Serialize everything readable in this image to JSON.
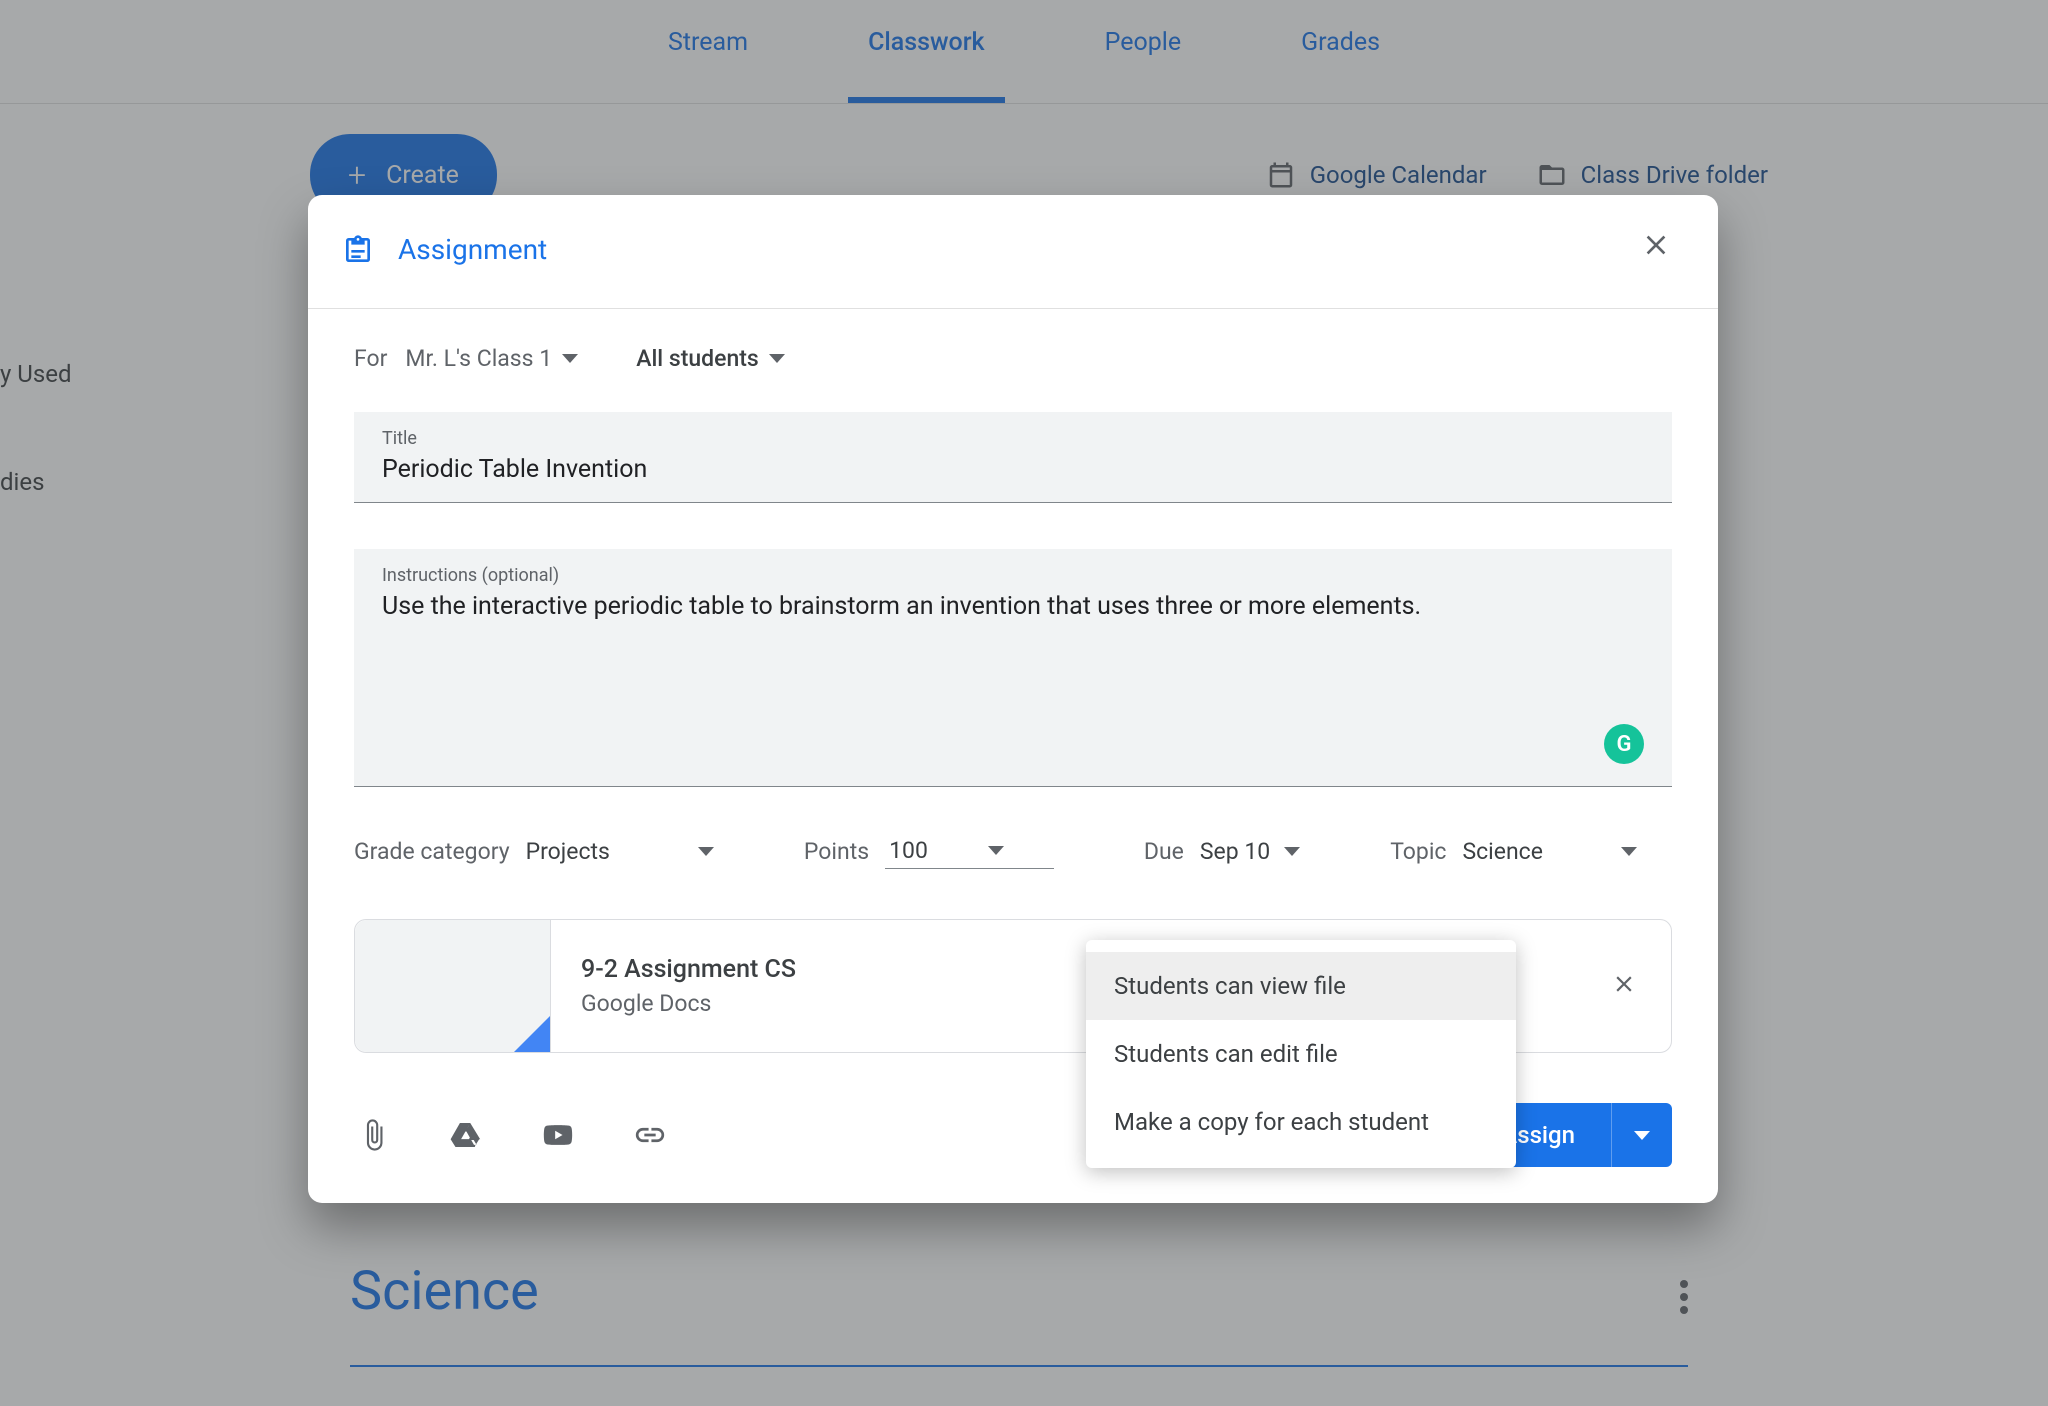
{
  "header_tabs": {
    "stream": "Stream",
    "classwork": "Classwork",
    "people": "People",
    "grades": "Grades"
  },
  "toolbar": {
    "create_label": "Create",
    "calendar_label": "Google Calendar",
    "drive_label": "Class Drive folder"
  },
  "sidebar": {
    "item1": "y Used",
    "item2": "dies"
  },
  "section": {
    "title": "Science"
  },
  "modal": {
    "title": "Assignment",
    "for_label": "For",
    "class_name": "Mr. L's Class 1",
    "students_label": "All students",
    "title_label": "Title",
    "title_value": "Periodic Table Invention",
    "instructions_label": "Instructions (optional)",
    "instructions_value": "Use the interactive periodic table to brainstorm an invention that uses three or more elements.",
    "grammarly": "G",
    "grade_category_label": "Grade category",
    "grade_category_value": "Projects",
    "points_label": "Points",
    "points_value": "100",
    "due_label": "Due",
    "due_value": "Sep 10",
    "topic_label": "Topic",
    "topic_value": "Science",
    "attachment": {
      "title": "9-2 Assignment CS",
      "type": "Google Docs"
    },
    "permission_menu": {
      "view": "Students can view file",
      "edit": "Students can edit file",
      "copy": "Make a copy for each student"
    },
    "assign_label": "Assign"
  }
}
